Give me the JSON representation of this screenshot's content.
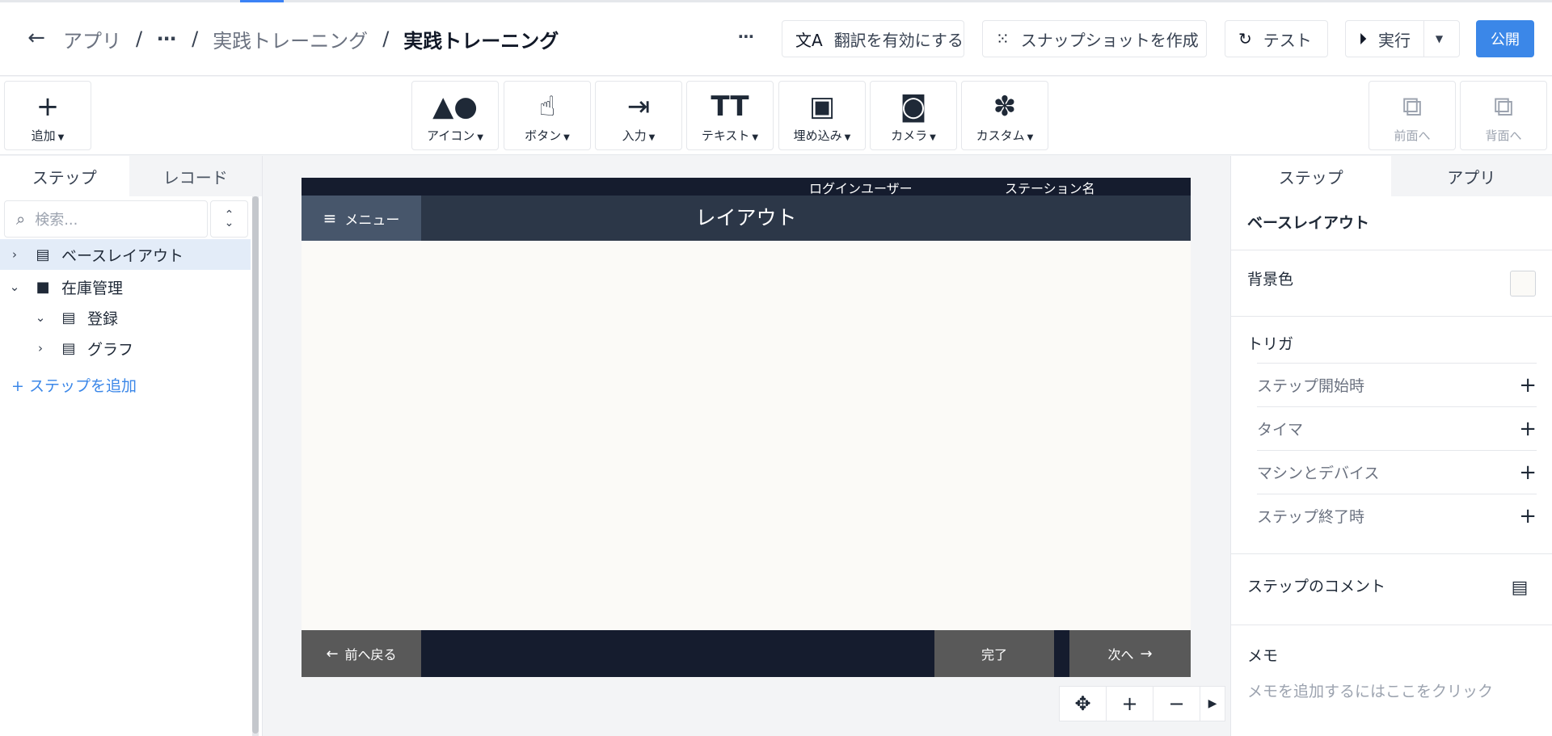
{
  "header": {
    "breadcrumb": [
      "アプリ",
      "⋯",
      "実践トレーニング",
      "実践トレーニング"
    ],
    "more": "⋯",
    "buttons": {
      "translate": "翻訳を有効にする",
      "snapshot": "スナップショットを作成",
      "test": "テスト",
      "run": "実行",
      "publish": "公開"
    }
  },
  "toolbar": {
    "add": "追加",
    "icon": "アイコン",
    "button": "ボタン",
    "input": "入力",
    "text": "テキスト",
    "embed": "埋め込み",
    "camera": "カメラ",
    "custom": "カスタム",
    "front": "前面へ",
    "back": "背面へ"
  },
  "left": {
    "tabs": [
      "ステップ",
      "レコード"
    ],
    "search_placeholder": "検索...",
    "tree": [
      {
        "label": "ベースレイアウト",
        "icon": "layout-icon"
      },
      {
        "label": "在庫管理",
        "icon": "folder-icon"
      },
      {
        "label": "登録",
        "icon": "step-icon"
      },
      {
        "label": "グラフ",
        "icon": "step-icon"
      }
    ],
    "add_step": "ステップを追加"
  },
  "canvas": {
    "login_user": "ログインユーザー",
    "station": "ステーション名",
    "menu": "メニュー",
    "title": "レイアウト",
    "prev": "前へ戻る",
    "done": "完了",
    "next": "次へ",
    "background_color": "#fbfaf7"
  },
  "right": {
    "tabs": [
      "ステップ",
      "アプリ"
    ],
    "section_title": "ベースレイアウト",
    "background_label": "背景色",
    "trigger_label": "トリガ",
    "triggers": [
      "ステップ開始時",
      "タイマ",
      "マシンとデバイス",
      "ステップ終了時"
    ],
    "comment_label": "ステップのコメント",
    "memo_label": "メモ",
    "memo_placeholder": "メモを追加するにはここをクリック"
  },
  "colors": {
    "accent": "#3b87e8",
    "header_dark": "#2c3748",
    "footer_dark": "#151c2e"
  }
}
